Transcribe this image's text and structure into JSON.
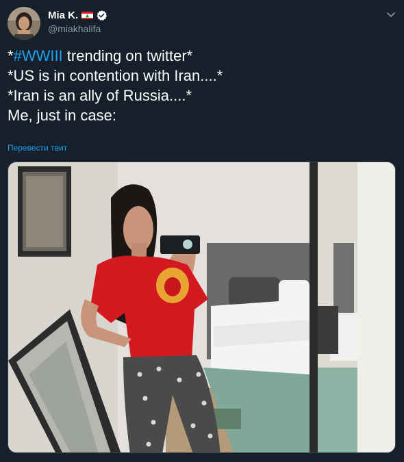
{
  "author": {
    "display_name": "Mia K.",
    "handle": "@miakhalifa",
    "flag_icon": "lebanon-flag-icon",
    "verified_icon": "verified-badge-icon"
  },
  "tweet": {
    "line1_prefix": "*",
    "hashtag": "#WWIII",
    "line1_suffix": " trending on twitter*",
    "line2": "*US is in contention with Iran....*",
    "line3": "*Iran is an ally of Russia....*",
    "line4": "Me, just in case:"
  },
  "translate_label": "Перевести твит",
  "colors": {
    "background": "#15202b",
    "link": "#1da1f2",
    "secondary_text": "#8899a6",
    "border": "#38444d"
  }
}
